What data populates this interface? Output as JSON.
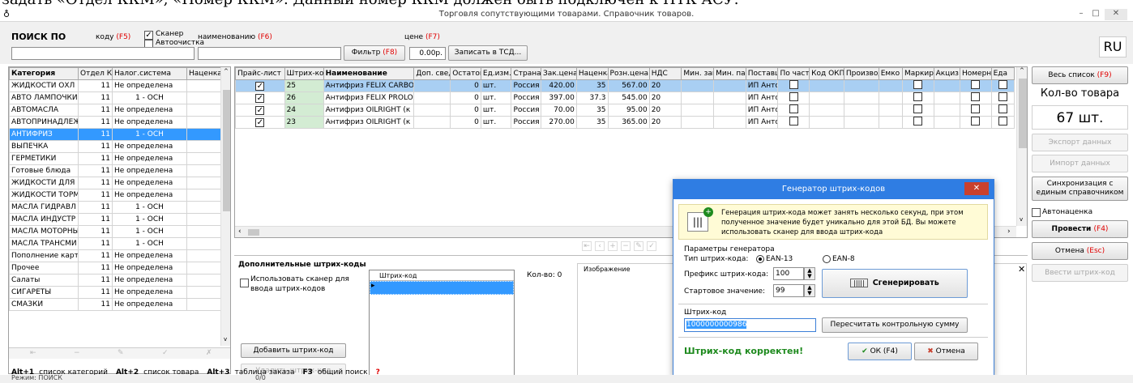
{
  "caption": "задать «Отдел ККМ», «Номер ККМ». Данный номер ККМ должен быть подключен к ПТК АСУ.",
  "window": {
    "title": "Торговля сопутствующими товарами. Справочник товаров.",
    "minimize": "–",
    "maximize": "□",
    "close": "✕"
  },
  "search": {
    "title": "ПОИСК ПО",
    "by_code": "коду",
    "code_key": "(F5)",
    "scanner": "Сканер",
    "autoclean": "Автоочистка",
    "by_name": "наименованию",
    "name_key": "(F6)",
    "filter": "Фильтр",
    "filter_key": "(F8)",
    "by_price": "цене",
    "price_key": "(F7)",
    "price_value": "0.00р.",
    "write_tsd": "Записать в ТСД...",
    "lang": "RU"
  },
  "categories": {
    "headers": [
      "Категория",
      "Отдел ККМ",
      "Налог.система",
      "Наценка"
    ],
    "rows": [
      [
        "ЖИДКОСТИ ОХЛ",
        "11",
        "Не определена",
        ""
      ],
      [
        "АВТО ЛАМПОЧКИ",
        "11",
        "1 - ОСН",
        ""
      ],
      [
        "АВТОМАСЛА",
        "11",
        "Не определена",
        ""
      ],
      [
        "АВТОПРИНАДЛЕЖ",
        "11",
        "Не определена",
        ""
      ],
      [
        "АНТИФРИЗ",
        "11",
        "1 - ОСН",
        ""
      ],
      [
        "ВЫПЕЧКА",
        "11",
        "Не определена",
        ""
      ],
      [
        "ГЕРМЕТИКИ",
        "11",
        "Не определена",
        ""
      ],
      [
        "Готовые блюда",
        "11",
        "Не определена",
        ""
      ],
      [
        "ЖИДКОСТИ ДЛЯ",
        "11",
        "Не определена",
        ""
      ],
      [
        "ЖИДКОСТИ ТОРМ",
        "11",
        "Не определена",
        ""
      ],
      [
        "МАСЛА ГИДРАВЛ",
        "11",
        "1 - ОСН",
        ""
      ],
      [
        "МАСЛА ИНДУСТР",
        "11",
        "1 - ОСН",
        ""
      ],
      [
        "МАСЛА МОТОРНЫ",
        "11",
        "1 - ОСН",
        ""
      ],
      [
        "МАСЛА ТРАНСМИ",
        "11",
        "1 - ОСН",
        ""
      ],
      [
        "Пополнение карт",
        "11",
        "Не определена",
        ""
      ],
      [
        "Прочее",
        "11",
        "Не определена",
        ""
      ],
      [
        "Салаты",
        "11",
        "Не определена",
        ""
      ],
      [
        "СИГАРЕТЫ",
        "11",
        "Не определена",
        ""
      ],
      [
        "СМАЗКИ",
        "11",
        "Не определена",
        ""
      ]
    ]
  },
  "products": {
    "headers": [
      "Прайс-лист",
      "Штрих-код",
      "Наименование",
      "Доп. свед.",
      "Остаток",
      "Ед.изм.",
      "Страна",
      "Зак.цена",
      "Наценка,",
      "Розн.цена",
      "НДС",
      "Мин. зак",
      "Мин. пар",
      "Поставщ",
      "По част",
      "Код ОКП",
      "Производ",
      "Емко",
      "Маркиро",
      "Акциз",
      "Номерн",
      "Еда"
    ],
    "rows": [
      [
        "✓",
        "25",
        "Антифриз FELIX CARBO",
        "",
        "0",
        "шт.",
        "Россия",
        "420.00",
        "35",
        "567.00",
        "20",
        "",
        "",
        "ИП Анто"
      ],
      [
        "✓",
        "26",
        "Антифриз FELIX PROLO",
        "",
        "0",
        "шт.",
        "Россия",
        "397.00",
        "37.3",
        "545.00",
        "20",
        "",
        "",
        "ИП Анто"
      ],
      [
        "✓",
        "24",
        "Антифриз OILRIGHT (к",
        "",
        "0",
        "шт.",
        "Россия",
        "70.00",
        "35",
        "95.00",
        "20",
        "",
        "",
        "ИП Анто"
      ],
      [
        "✓",
        "23",
        "Антифриз OILRIGHT (к",
        "",
        "0",
        "шт.",
        "Россия",
        "270.00",
        "35",
        "365.00",
        "20",
        "",
        "",
        "ИП Анто"
      ]
    ]
  },
  "extra": {
    "title": "Дополнительные штрих-коды",
    "use_scanner": "Использовать сканер для ввода штрих-кодов",
    "add": "Добавить штрих-код",
    "remove": "Удалить штрих-код",
    "col": "Штрих-код",
    "count": "Кол-во: 0",
    "image": "Изображение"
  },
  "right": {
    "all_list": "Весь список",
    "all_key": "(F9)",
    "count_label": "Кол-во товара",
    "count_value": "67 шт.",
    "export": "Экспорт данных",
    "import": "Импорт данных",
    "sync": "Синхронизация с единым справочником",
    "autonacenka": "Автонаценка",
    "post": "Провести",
    "post_key": "(F4)",
    "cancel": "Отмена",
    "cancel_key": "(Esc)",
    "enter_barcode": "Ввести штрих-код"
  },
  "hotkeys": [
    {
      "k": "Alt+1",
      "t": "список категорий"
    },
    {
      "k": "Alt+2",
      "t": "список товара"
    },
    {
      "k": "Alt+3",
      "t": "таблица заказа"
    },
    {
      "k": "F3",
      "t": "общий поиск"
    }
  ],
  "help": "?",
  "status": {
    "mode": "Режим: ПОИСК",
    "count": "0/0"
  },
  "dialog": {
    "title": "Генератор штрих-кодов",
    "close": "✕",
    "info": "Генерация штрих-кода может занять несколько секунд, при этом полученное значение будет уникально для этой БД. Вы можете использовать сканер для ввода штрих-кода",
    "params": "Параметры генератора",
    "type_label": "Тип штрих-кода:",
    "ean13": "EAN-13",
    "ean8": "EAN-8",
    "prefix_label": "Префикс штрих-кода:",
    "prefix": "100",
    "start_label": "Стартовое значение:",
    "start": "99",
    "generate": "Сгенерировать",
    "barcode_label": "Штрих-код",
    "barcode": "1000000000986",
    "recalc": "Пересчитать контрольную сумму",
    "status": "Штрих-код корректен!",
    "ok": "ОК (F4)",
    "cancel": "Отмена"
  },
  "colors": {
    "accent": "#2f7de3",
    "selection": "#3399ff",
    "success": "#1e8a1e",
    "danger": "#c9402d",
    "barcode_cell": "#d3ecd3"
  }
}
